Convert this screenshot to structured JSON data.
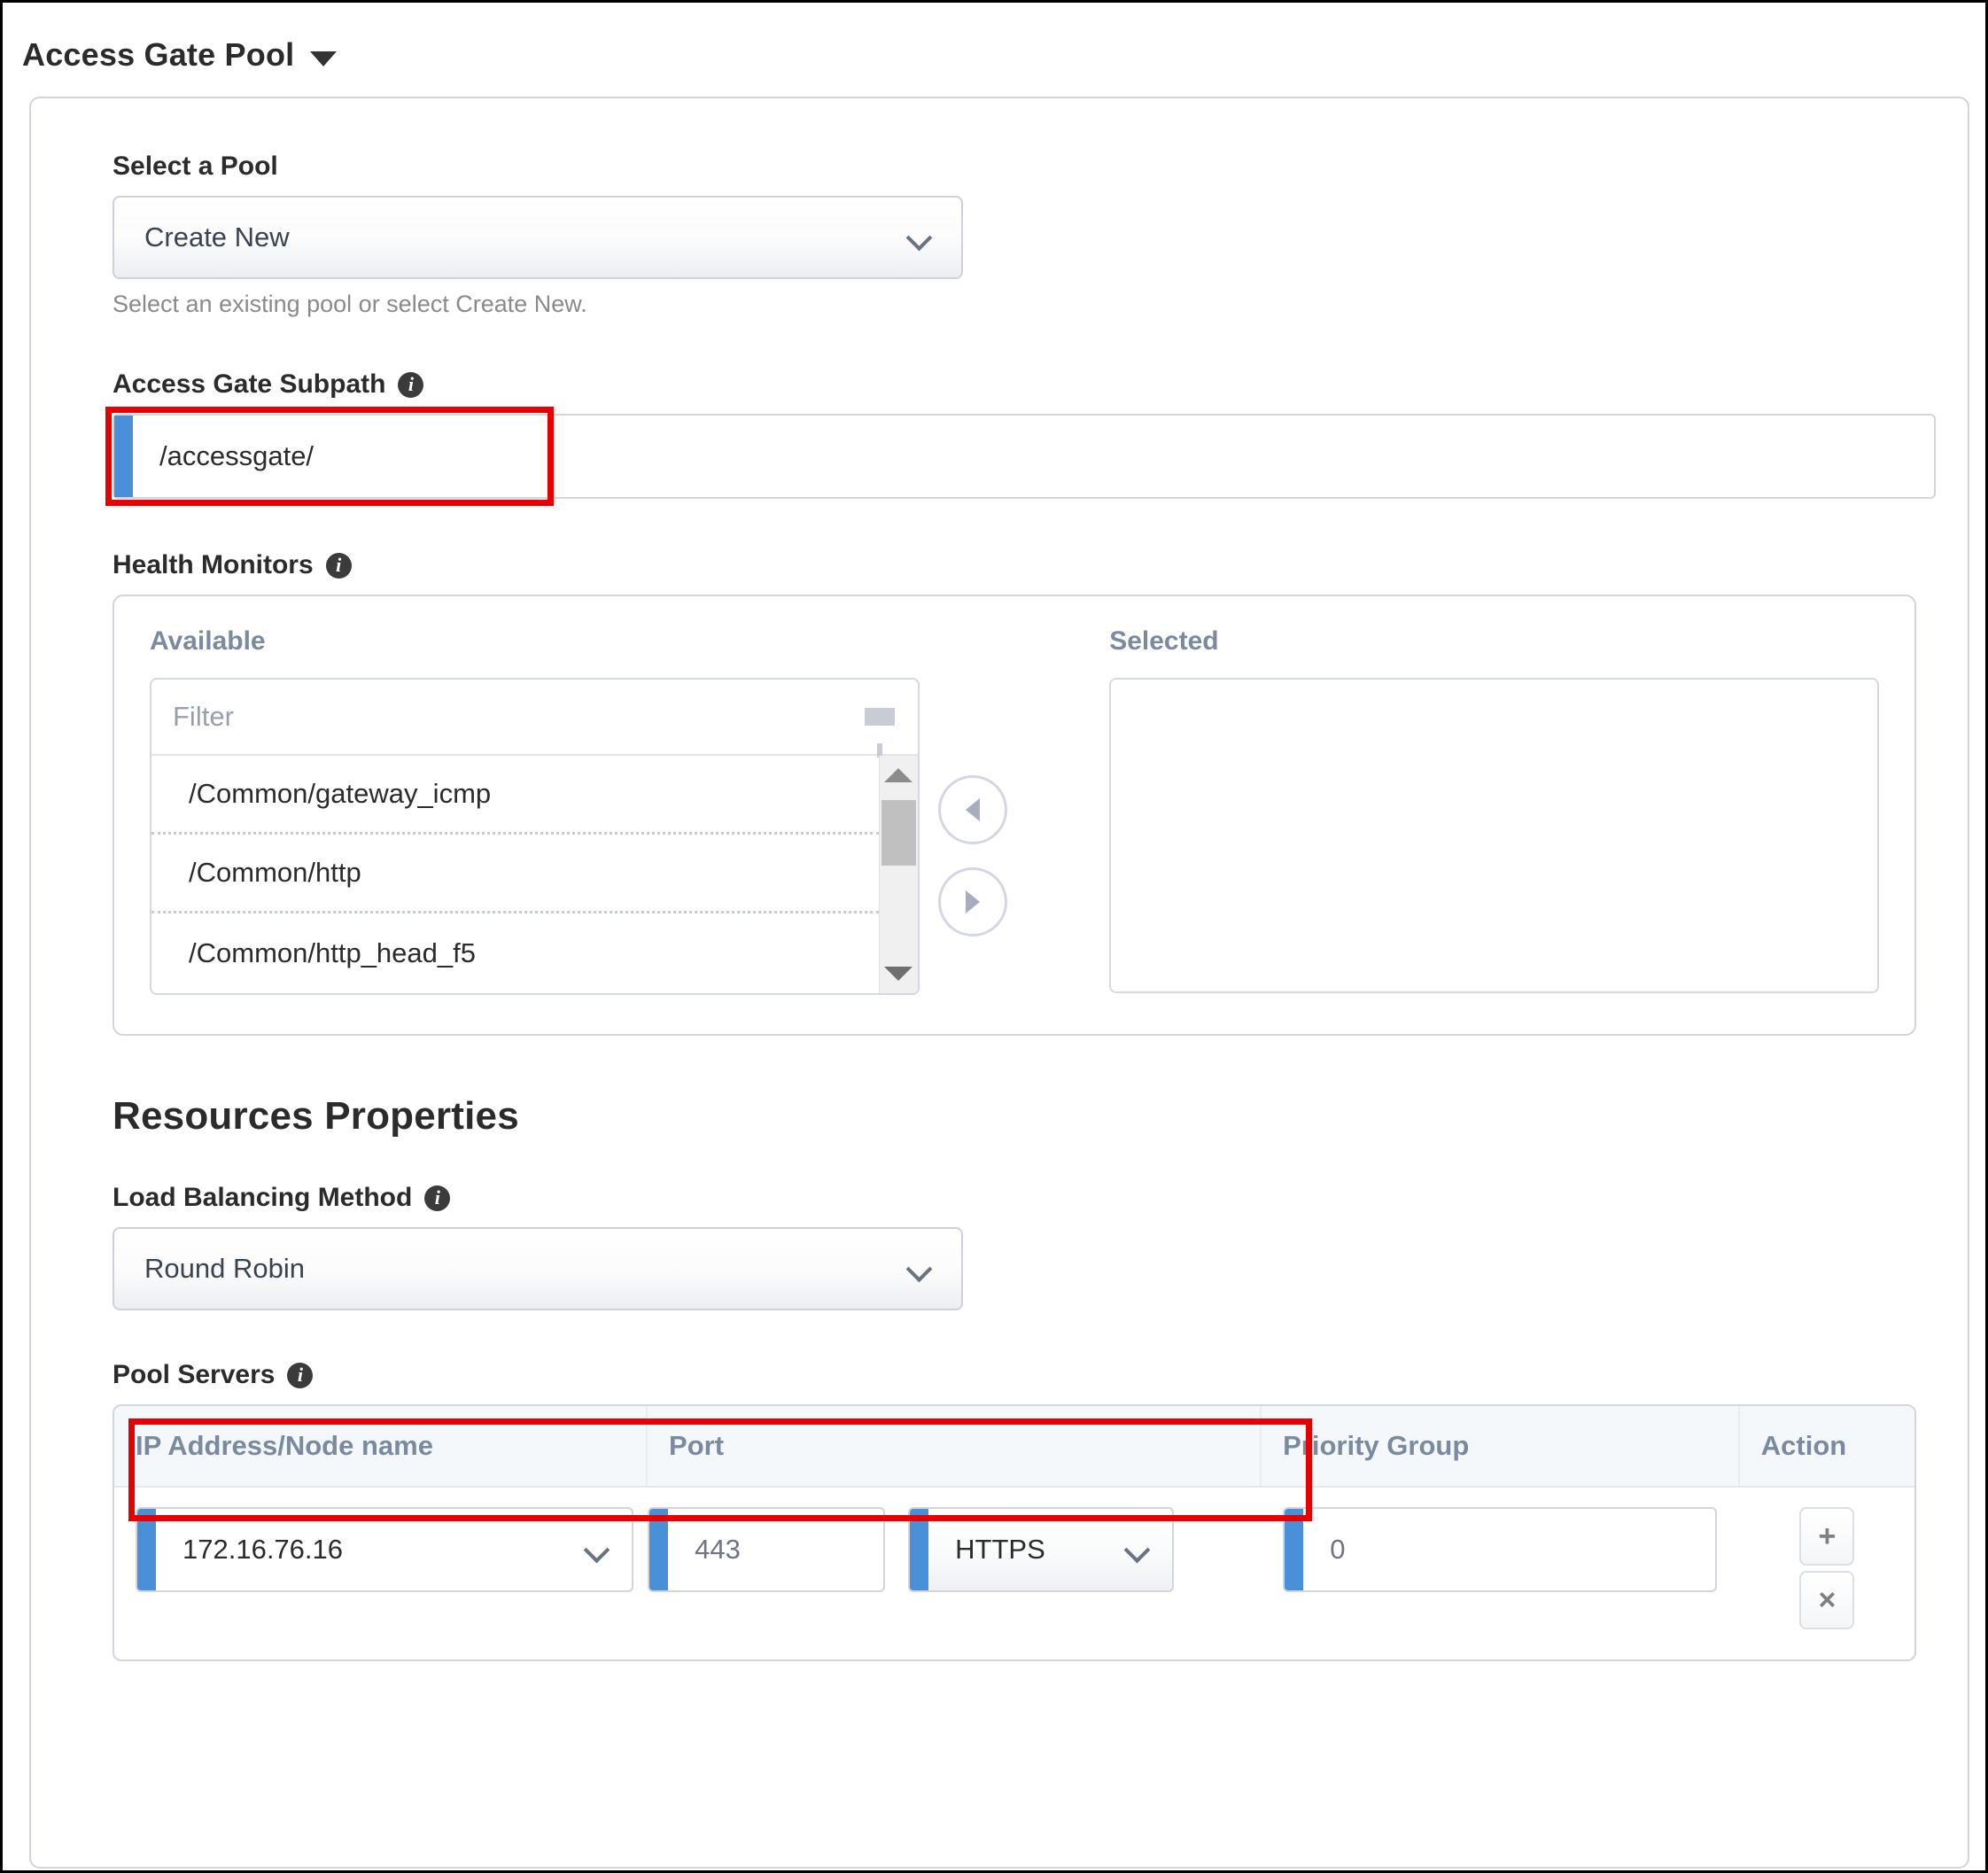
{
  "header": {
    "title": "Access Gate Pool",
    "collapse_icon": "caret-down-icon"
  },
  "select_pool": {
    "label": "Select a Pool",
    "value": "Create New",
    "help": "Select an existing pool or select Create New.",
    "chevron_icon": "chevron-down-icon"
  },
  "subpath": {
    "label": "Access Gate Subpath",
    "info_icon": "info-icon",
    "value": "/accessgate/",
    "highlight_color": "#e60000",
    "accent_color": "#4a90d9"
  },
  "health_monitors": {
    "label": "Health Monitors",
    "info_icon": "info-icon",
    "available_label": "Available",
    "selected_label": "Selected",
    "filter_placeholder": "Filter",
    "filter_value": "",
    "filter_icon": "funnel-icon",
    "available_items": [
      "/Common/gateway_icmp",
      "/Common/http",
      "/Common/http_head_f5"
    ],
    "selected_items": [],
    "move_left_icon": "triangle-left-icon",
    "move_right_icon": "triangle-right-icon",
    "scroll_up_icon": "triangle-up-icon",
    "scroll_down_icon": "triangle-down-icon"
  },
  "resources": {
    "title": "Resources Properties",
    "load_balancing": {
      "label": "Load Balancing Method",
      "info_icon": "info-icon",
      "value": "Round Robin",
      "chevron_icon": "chevron-down-icon"
    },
    "pool_servers": {
      "label": "Pool Servers",
      "info_icon": "info-icon",
      "columns": [
        "IP Address/Node name",
        "Port",
        "Priority Group",
        "Action"
      ],
      "rows": [
        {
          "ip": "172.16.76.16",
          "port": "443",
          "protocol": "HTTPS",
          "priority_group": "0",
          "add_label": "+",
          "remove_label": "×"
        }
      ]
    }
  }
}
